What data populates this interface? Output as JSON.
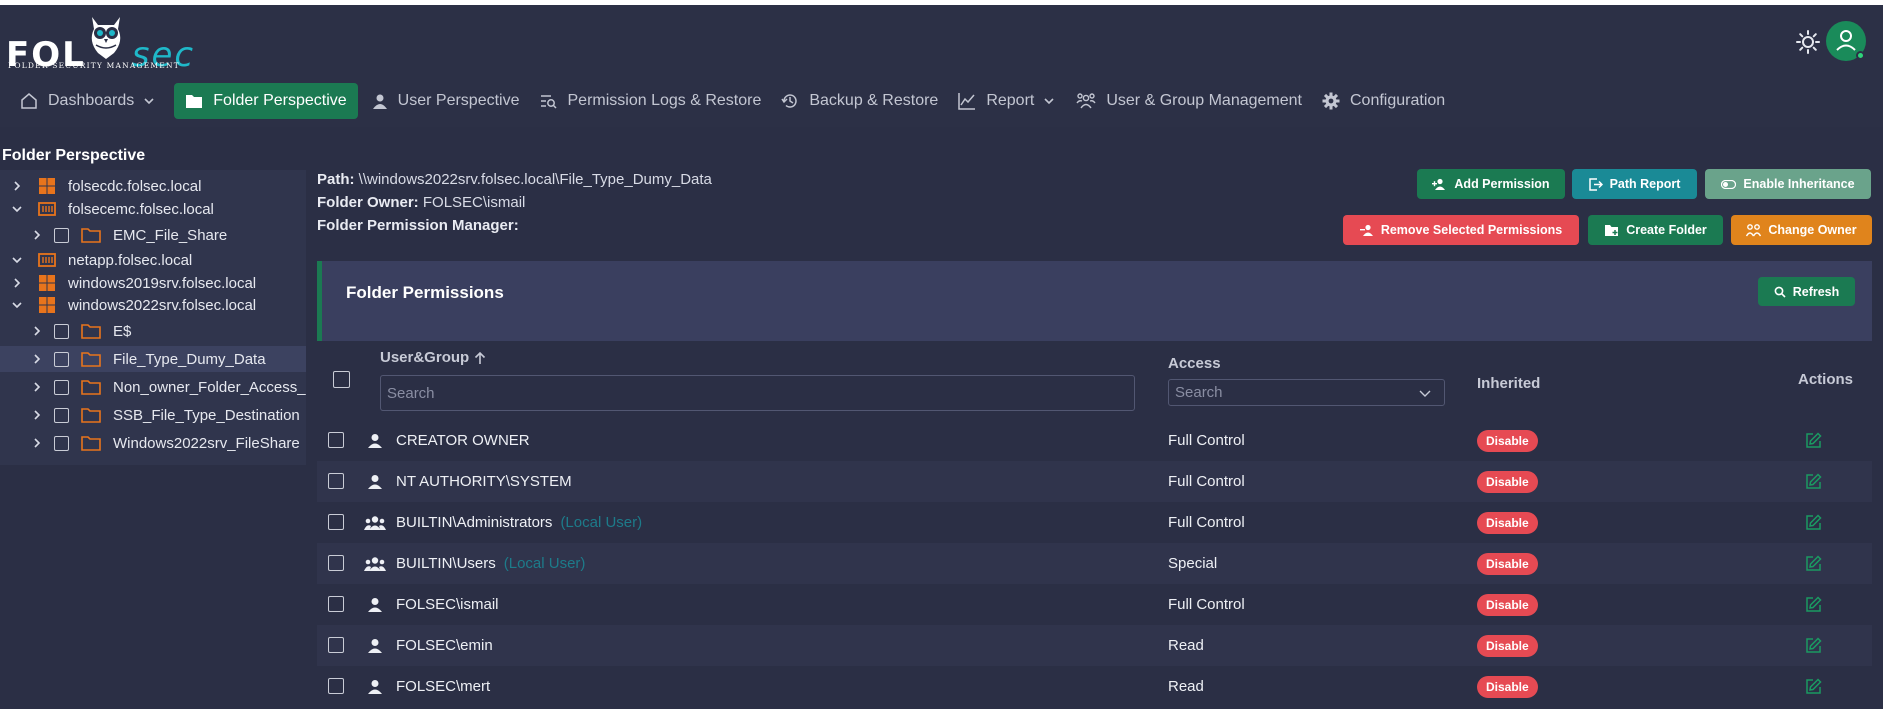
{
  "app": {
    "logo_text_left": "FOL",
    "logo_text_right": "sec",
    "logo_subtitle": "FOLDER SECURITY MANAGEMENT"
  },
  "nav": {
    "items": [
      {
        "label": "Dashboards",
        "icon": "home-icon",
        "dropdown": true
      },
      {
        "label": "Folder Perspective",
        "icon": "folder-icon",
        "active": true
      },
      {
        "label": "User Perspective",
        "icon": "user-icon"
      },
      {
        "label": "Permission Logs & Restore",
        "icon": "logs-search-icon"
      },
      {
        "label": "Backup & Restore",
        "icon": "history-icon"
      },
      {
        "label": "Report",
        "icon": "chart-line-icon",
        "dropdown": true
      },
      {
        "label": "User & Group Management",
        "icon": "users-icon"
      },
      {
        "label": "Configuration",
        "icon": "gear-icon"
      }
    ]
  },
  "tree": {
    "title": "Folder Perspective",
    "items": [
      {
        "label": "folsecdc.folsec.local",
        "level": 0,
        "expanded": false,
        "kind": "windows"
      },
      {
        "label": "folsecemc.folsec.local",
        "level": 0,
        "expanded": true,
        "kind": "storage"
      },
      {
        "label": "EMC_File_Share",
        "level": 1,
        "expanded": false,
        "kind": "folder"
      },
      {
        "label": "netapp.folsec.local",
        "level": 0,
        "expanded": true,
        "kind": "storage"
      },
      {
        "label": "windows2019srv.folsec.local",
        "level": 0,
        "expanded": false,
        "kind": "windows"
      },
      {
        "label": "windows2022srv.folsec.local",
        "level": 0,
        "expanded": true,
        "kind": "windows"
      },
      {
        "label": "E$",
        "level": 1,
        "expanded": false,
        "kind": "folder"
      },
      {
        "label": "File_Type_Dumy_Data",
        "level": 1,
        "expanded": false,
        "kind": "folder",
        "selected": true
      },
      {
        "label": "Non_owner_Folder_Access_",
        "level": 1,
        "expanded": false,
        "kind": "folder"
      },
      {
        "label": "SSB_File_Type_Destination",
        "level": 1,
        "expanded": false,
        "kind": "folder"
      },
      {
        "label": "Windows2022srv_FileShare",
        "level": 1,
        "expanded": false,
        "kind": "folder"
      }
    ]
  },
  "info": {
    "path_label": "Path:",
    "path_value": "\\\\windows2022srv.folsec.local\\File_Type_Dumy_Data",
    "owner_label": "Folder Owner:",
    "owner_value": "FOLSEC\\ismail",
    "manager_label": "Folder Permission Manager:"
  },
  "actions": {
    "add_permission": "Add Permission",
    "path_report": "Path Report",
    "enable_inheritance": "Enable Inheritance",
    "remove_selected": "Remove Selected Permissions",
    "create_folder": "Create Folder",
    "change_owner": "Change Owner"
  },
  "colors": {
    "green": "#1b7a52",
    "teal": "#1a8a96",
    "muted_green": "#6aa38b",
    "red": "#e64a53",
    "orange": "#e0841c"
  },
  "permissions": {
    "title": "Folder Permissions",
    "refresh_label": "Refresh",
    "columns": {
      "user_group": "User&Group",
      "access": "Access",
      "inherited": "Inherited",
      "actions": "Actions"
    },
    "user_search_placeholder": "Search",
    "access_search_placeholder": "Search",
    "rows": [
      {
        "name": "CREATOR OWNER",
        "type": "",
        "icon": "user",
        "access": "Full Control",
        "inherited": "Disable"
      },
      {
        "name": "NT AUTHORITY\\SYSTEM",
        "type": "",
        "icon": "user",
        "access": "Full Control",
        "inherited": "Disable"
      },
      {
        "name": "BUILTIN\\Administrators",
        "type": "(Local User)",
        "icon": "group",
        "access": "Full Control",
        "inherited": "Disable"
      },
      {
        "name": "BUILTIN\\Users",
        "type": "(Local User)",
        "icon": "group",
        "access": "Special",
        "inherited": "Disable"
      },
      {
        "name": "FOLSEC\\ismail",
        "type": "",
        "icon": "user",
        "access": "Full Control",
        "inherited": "Disable"
      },
      {
        "name": "FOLSEC\\emin",
        "type": "",
        "icon": "user",
        "access": "Read",
        "inherited": "Disable"
      },
      {
        "name": "FOLSEC\\mert",
        "type": "",
        "icon": "user",
        "access": "Read",
        "inherited": "Disable"
      }
    ]
  }
}
